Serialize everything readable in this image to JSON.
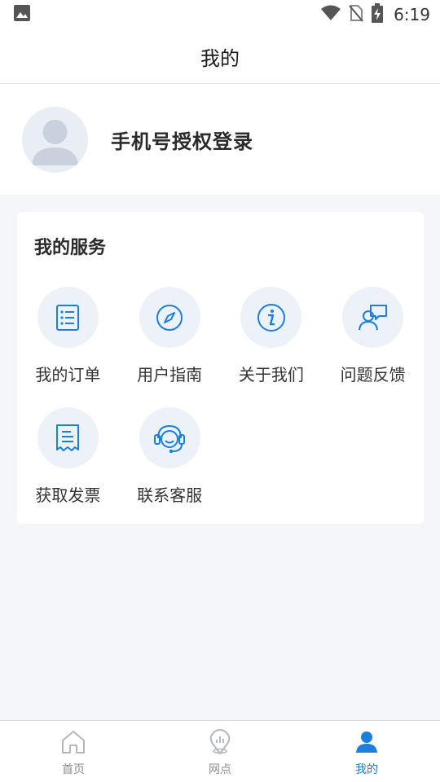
{
  "status_bar": {
    "time": "6:19",
    "icons": [
      "image-icon",
      "wifi-icon",
      "no-sim-icon",
      "battery-charging-icon"
    ]
  },
  "header": {
    "title": "我的"
  },
  "profile": {
    "login_text": "手机号授权登录",
    "avatar_icon": "user-avatar-icon"
  },
  "services": {
    "title": "我的服务",
    "items": [
      {
        "label": "我的订单",
        "icon": "order-list-icon"
      },
      {
        "label": "用户指南",
        "icon": "compass-icon"
      },
      {
        "label": "关于我们",
        "icon": "info-icon"
      },
      {
        "label": "问题反馈",
        "icon": "feedback-icon"
      },
      {
        "label": "获取发票",
        "icon": "invoice-icon"
      },
      {
        "label": "联系客服",
        "icon": "customer-service-icon"
      }
    ]
  },
  "tab_bar": {
    "tabs": [
      {
        "label": "首页",
        "icon": "home-icon",
        "active": false
      },
      {
        "label": "网点",
        "icon": "location-icon",
        "active": false
      },
      {
        "label": "我的",
        "icon": "person-icon",
        "active": true
      }
    ]
  },
  "colors": {
    "accent": "#1b7fe0",
    "icon_bg": "#edf2f9",
    "page_bg": "#f4f6f9",
    "inactive_tab": "#8a8f96"
  }
}
